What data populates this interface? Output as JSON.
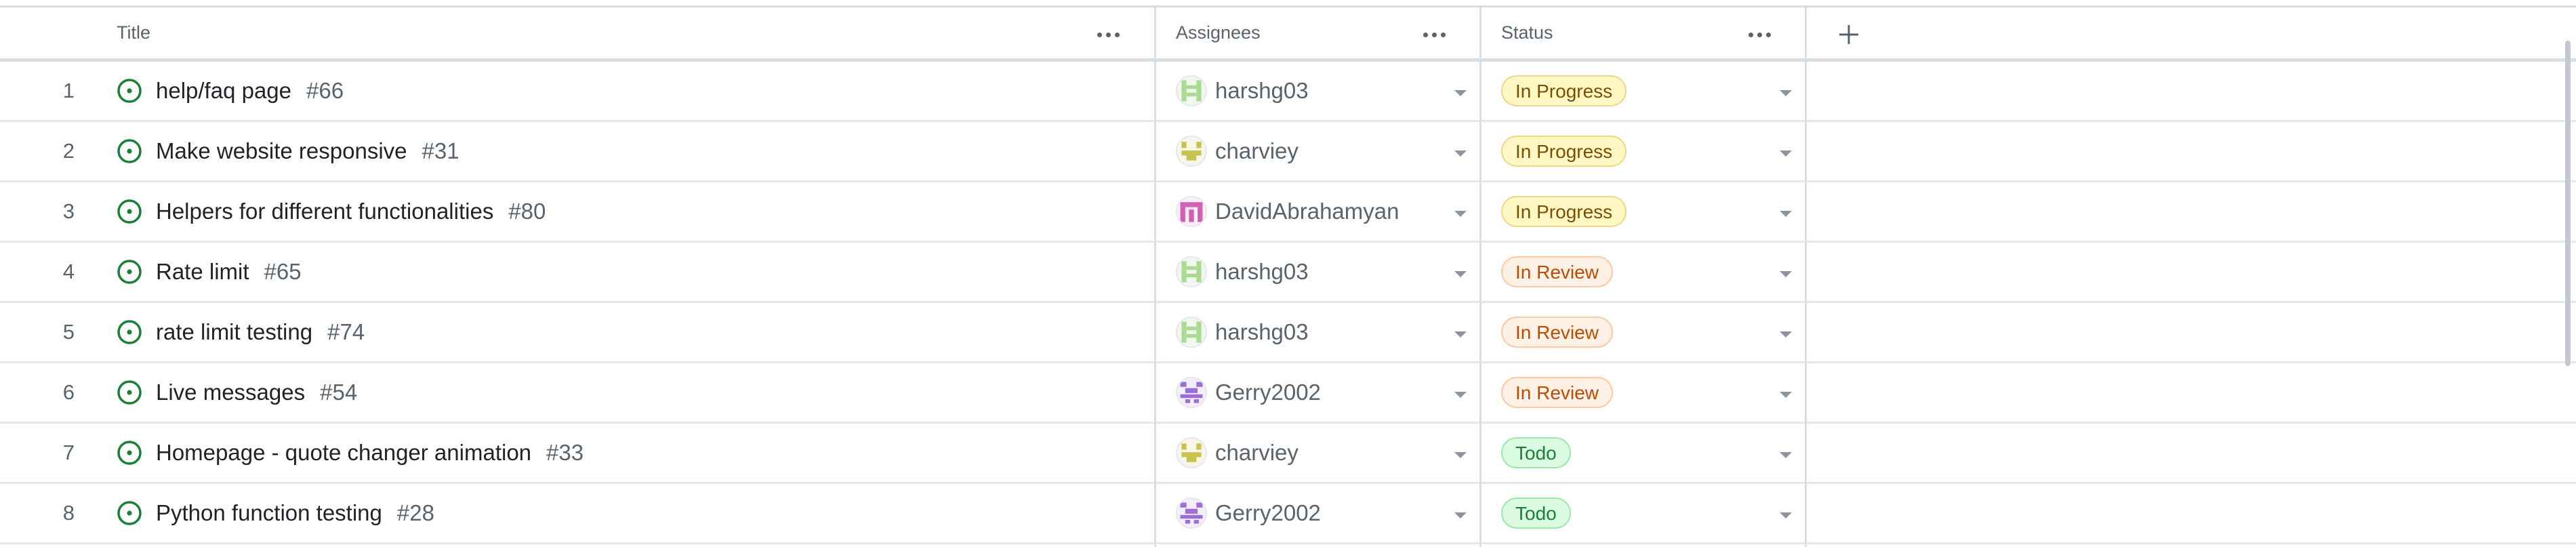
{
  "header": {
    "title_label": "Title",
    "assignees_label": "Assignees",
    "status_label": "Status",
    "add_field_icon": "plus-icon",
    "column_menu_icon": "kebab-horizontal-icon"
  },
  "rows": [
    {
      "num": "1",
      "title": "help/faq page",
      "issue": "#66",
      "assignee": "harshg03",
      "avatar": "a1",
      "status": "In Progress",
      "status_color": "yellow"
    },
    {
      "num": "2",
      "title": "Make website responsive",
      "issue": "#31",
      "assignee": "charviey",
      "avatar": "a2",
      "status": "In Progress",
      "status_color": "yellow"
    },
    {
      "num": "3",
      "title": "Helpers for different functionalities",
      "issue": "#80",
      "assignee": "DavidAbrahamyan",
      "avatar": "a3",
      "status": "In Progress",
      "status_color": "yellow"
    },
    {
      "num": "4",
      "title": "Rate limit",
      "issue": "#65",
      "assignee": "harshg03",
      "avatar": "a1",
      "status": "In Review",
      "status_color": "orange"
    },
    {
      "num": "5",
      "title": "rate limit testing",
      "issue": "#74",
      "assignee": "harshg03",
      "avatar": "a1",
      "status": "In Review",
      "status_color": "orange"
    },
    {
      "num": "6",
      "title": "Live messages",
      "issue": "#54",
      "assignee": "Gerry2002",
      "avatar": "a4",
      "status": "In Review",
      "status_color": "orange"
    },
    {
      "num": "7",
      "title": "Homepage - quote changer animation",
      "issue": "#33",
      "assignee": "charviey",
      "avatar": "a2",
      "status": "Todo",
      "status_color": "green"
    },
    {
      "num": "8",
      "title": "Python function testing",
      "issue": "#28",
      "assignee": "Gerry2002",
      "avatar": "a4",
      "status": "Todo",
      "status_color": "green"
    }
  ],
  "colors": {
    "open_issue": "#1a7f37",
    "in_progress_bg": "#fff8c5",
    "in_review_bg": "#fff1e5",
    "todo_bg": "#dafbe1",
    "border": "#d8dee4"
  }
}
